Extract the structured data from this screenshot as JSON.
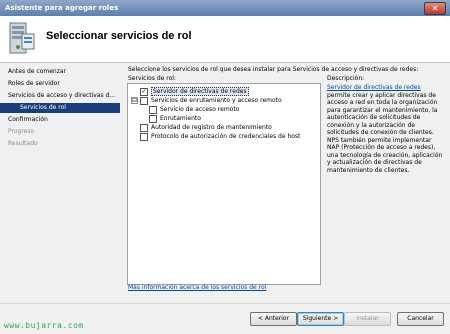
{
  "window": {
    "title": "Asistente para agregar roles",
    "close_glyph": "✕"
  },
  "header": {
    "title": "Seleccionar servicios de rol",
    "icon": "server-wizard-icon"
  },
  "nav": {
    "items": [
      {
        "label": "Antes de comenzar",
        "state": "normal"
      },
      {
        "label": "Roles de servidor",
        "state": "normal"
      },
      {
        "label": "Servicios de acceso y directivas d...",
        "state": "normal"
      },
      {
        "label": "Servicios de rol",
        "state": "selected"
      },
      {
        "label": "Confirmación",
        "state": "normal"
      },
      {
        "label": "Progreso",
        "state": "disabled"
      },
      {
        "label": "Resultado",
        "state": "disabled"
      }
    ]
  },
  "main": {
    "intro": "Seleccione los servicios de rol que desea instalar para Servicios de acceso y directivas de redes:",
    "roles_label": "Servicios de rol:",
    "tree": [
      {
        "label": "Servidor de directivas de redes",
        "checked": true
      },
      {
        "label": "Servicios de enrutamiento y acceso remoto",
        "checked": false,
        "expander": "⊟"
      },
      {
        "label": "Servicio de acceso remoto",
        "checked": false
      },
      {
        "label": "Enrutamiento",
        "checked": false
      },
      {
        "label": "Autoridad de registro de mantenimiento",
        "checked": false
      },
      {
        "label": "Protocolo de autorización de credenciales de host",
        "checked": false
      }
    ],
    "description_label": "Descripción:",
    "description_link": "Servidor de directivas de redes",
    "description_body": "permite crear y aplicar directivas de acceso a red en toda la organización para garantizar el mantenimiento, la autenticación de solicitudes de conexión y la autorización de solicitudes de conexión de clientes. NPS también permite implementar NAP (Protección de acceso a redes), una tecnología de creación, aplicación y actualización de directivas de mantenimiento de clientes.",
    "more_info_link": "Más información acerca de los servicios de rol"
  },
  "footer": {
    "back": "< Anterior",
    "next": "Siguiente >",
    "install": "Instalar",
    "cancel": "Cancelar"
  },
  "watermark": "www.bujarra.com",
  "colors": {
    "nav_selected": "#1b3f7a",
    "link": "#0645ad",
    "watermark": "#2fa84a"
  }
}
